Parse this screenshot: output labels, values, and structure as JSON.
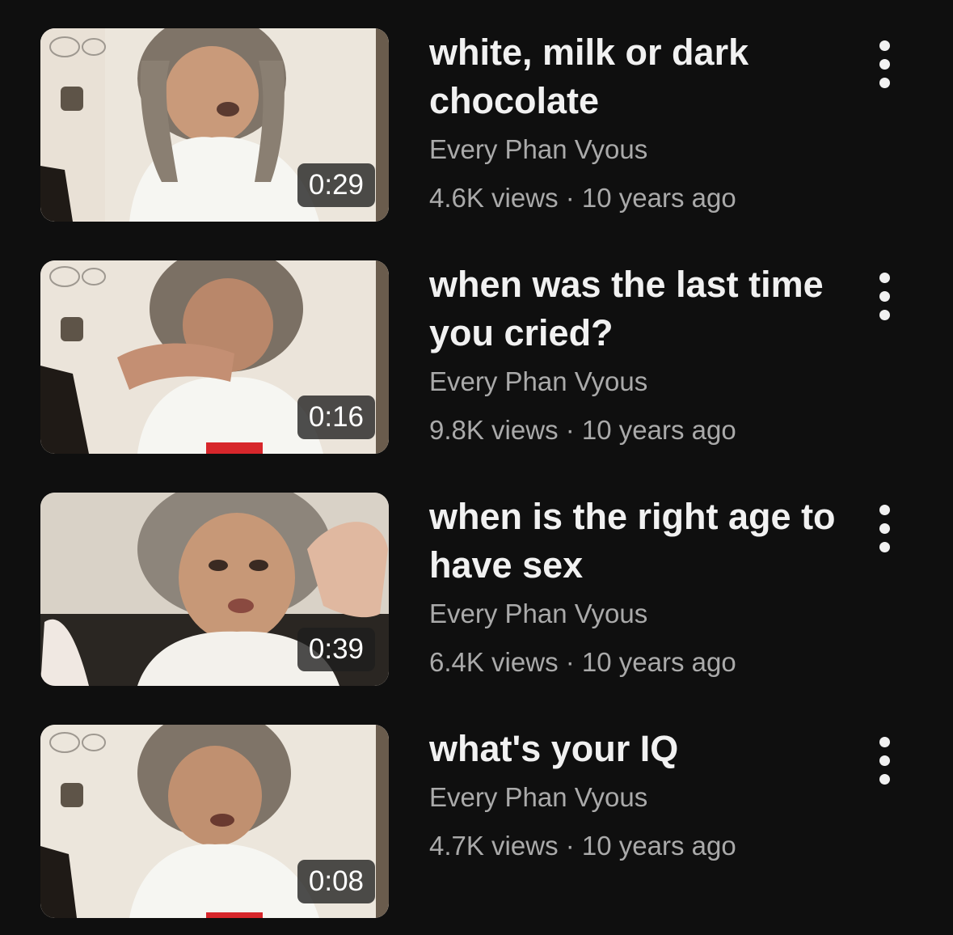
{
  "videos": [
    {
      "title": "white, milk or dark chocolate",
      "channel": "Every Phan Vyous",
      "views": "4.6K views",
      "separator": "·",
      "age": "10 years ago",
      "duration": "0:29",
      "menu_icon": "more-vertical-icon"
    },
    {
      "title": "when was the last time you cried?",
      "channel": "Every Phan Vyous",
      "views": "9.8K views",
      "separator": "·",
      "age": "10 years ago",
      "duration": "0:16",
      "menu_icon": "more-vertical-icon"
    },
    {
      "title": "when is the right age to have sex",
      "channel": "Every Phan Vyous",
      "views": "6.4K views",
      "separator": "·",
      "age": "10 years ago",
      "duration": "0:39",
      "menu_icon": "more-vertical-icon"
    },
    {
      "title": "what's your IQ",
      "channel": "Every Phan Vyous",
      "views": "4.7K views",
      "separator": "·",
      "age": "10 years ago",
      "duration": "0:08",
      "menu_icon": "more-vertical-icon"
    }
  ],
  "colors": {
    "background": "#0f0f0f",
    "title": "#f1f1f1",
    "secondary_text": "#aaaaaa",
    "duration_badge": "#1e1e1e"
  }
}
